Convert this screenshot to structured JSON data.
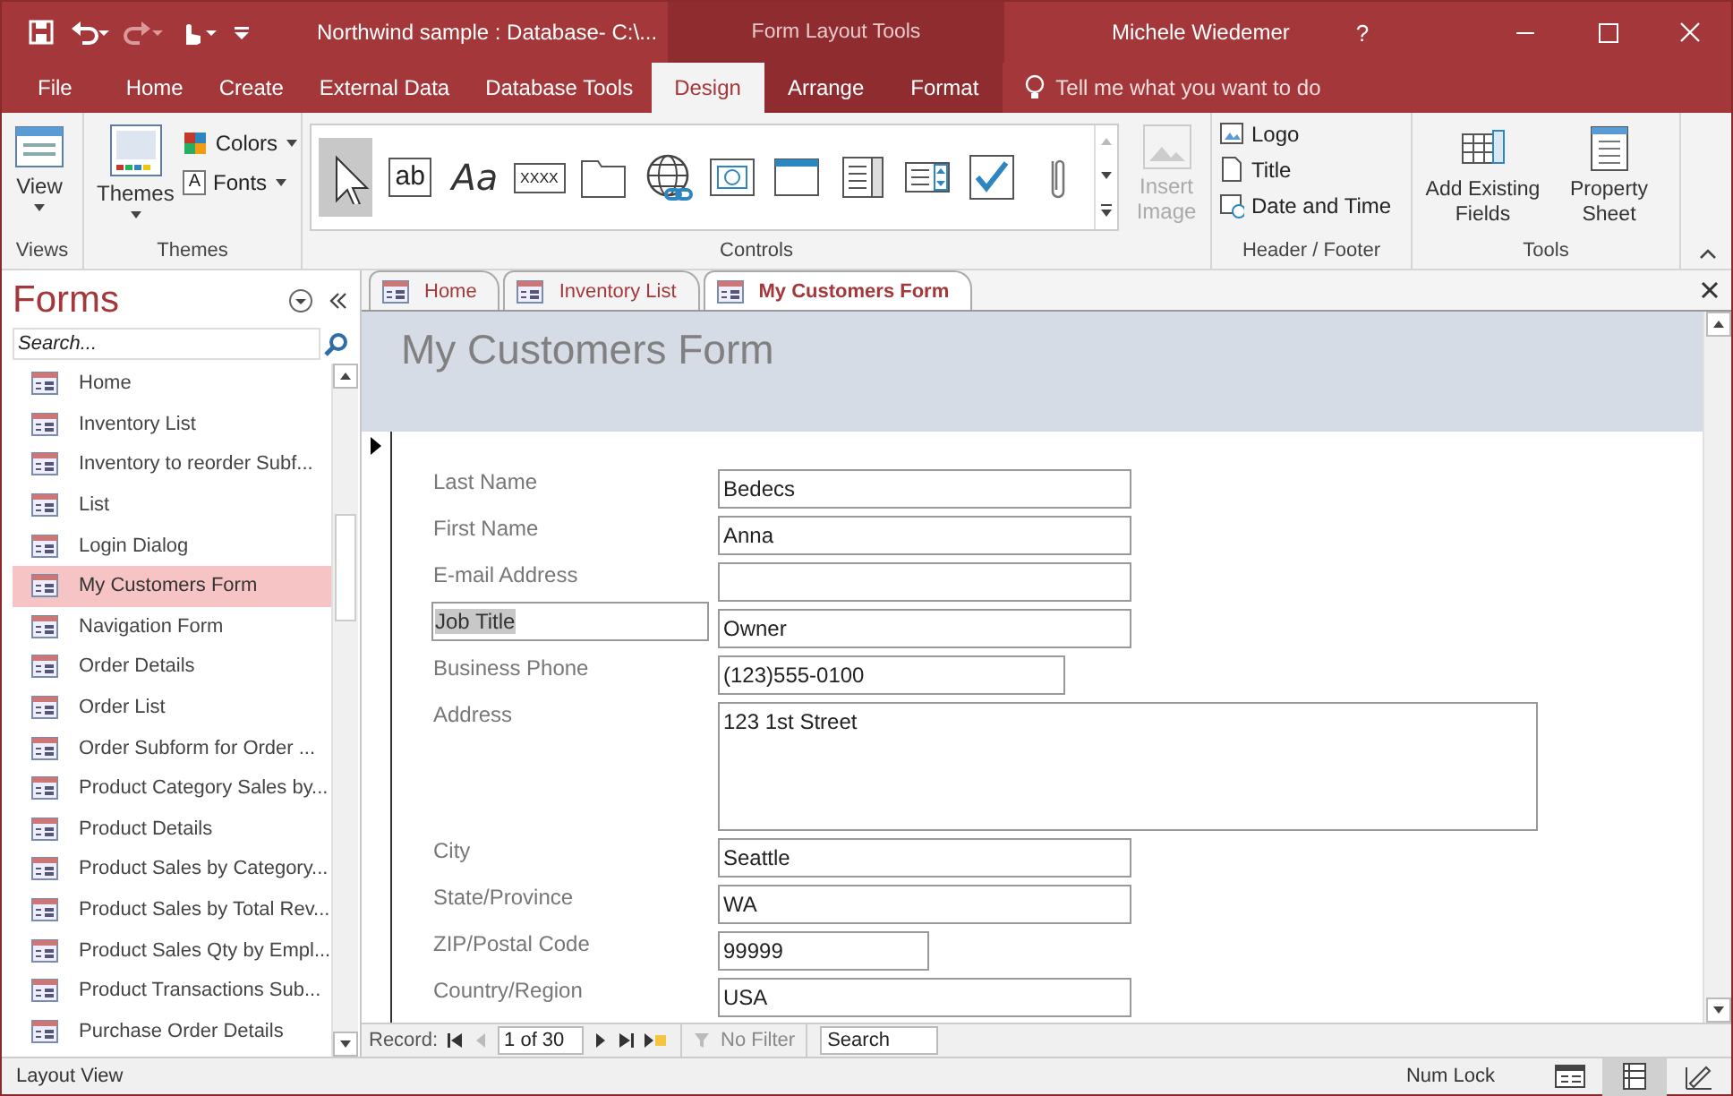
{
  "title_bar": {
    "title": "Northwind sample : Database- C:\\...",
    "context_label": "Form Layout Tools",
    "user": "Michele Wiedemer",
    "help": "?"
  },
  "ribbon_tabs": [
    {
      "label": "File",
      "selected": false,
      "contextual": false
    },
    {
      "label": "Home",
      "selected": false,
      "contextual": false
    },
    {
      "label": "Create",
      "selected": false,
      "contextual": false
    },
    {
      "label": "External Data",
      "selected": false,
      "contextual": false
    },
    {
      "label": "Database Tools",
      "selected": false,
      "contextual": false
    },
    {
      "label": "Design",
      "selected": true,
      "contextual": true
    },
    {
      "label": "Arrange",
      "selected": false,
      "contextual": true
    },
    {
      "label": "Format",
      "selected": false,
      "contextual": true
    }
  ],
  "tell_me": {
    "placeholder": "Tell me what you want to do"
  },
  "ribbon": {
    "views": {
      "label": "Views",
      "view": "View"
    },
    "themes": {
      "label": "Themes",
      "themes": "Themes",
      "colors": "Colors",
      "fonts": "Fonts",
      "fonts_glyph": "A"
    },
    "controls": {
      "label": "Controls",
      "items": [
        {
          "kind": "pointer",
          "selected": true
        },
        {
          "kind": "textbox",
          "text": "ab",
          "selected": false
        },
        {
          "kind": "label",
          "text": "Aa",
          "selected": false
        },
        {
          "kind": "button",
          "text": "XXXX",
          "selected": false
        },
        {
          "kind": "tab",
          "selected": false
        },
        {
          "kind": "hyperlink",
          "selected": false
        },
        {
          "kind": "browser",
          "selected": false
        },
        {
          "kind": "navigation",
          "selected": false
        },
        {
          "kind": "combo",
          "selected": false
        },
        {
          "kind": "list",
          "selected": false
        },
        {
          "kind": "checkbox",
          "selected": false
        },
        {
          "kind": "attachment",
          "selected": false
        }
      ],
      "insert_image": {
        "label": "Insert Image",
        "disabled": true
      }
    },
    "header_footer": {
      "label": "Header / Footer",
      "items": [
        {
          "kind": "logo",
          "label": "Logo"
        },
        {
          "kind": "title",
          "label": "Title"
        },
        {
          "kind": "date",
          "label": "Date and Time"
        }
      ]
    },
    "tools": {
      "label": "Tools",
      "items": [
        {
          "kind": "fields",
          "label": "Add Existing Fields"
        },
        {
          "kind": "sheet",
          "label": "Property Sheet"
        }
      ]
    }
  },
  "nav_pane": {
    "title": "Forms",
    "search": {
      "placeholder": "Search..."
    },
    "items": [
      {
        "label": "Home",
        "selected": false
      },
      {
        "label": "Inventory List",
        "selected": false
      },
      {
        "label": "Inventory to reorder Subf...",
        "selected": false
      },
      {
        "label": "List",
        "selected": false
      },
      {
        "label": "Login Dialog",
        "selected": false
      },
      {
        "label": "My Customers Form",
        "selected": true
      },
      {
        "label": "Navigation Form",
        "selected": false
      },
      {
        "label": "Order Details",
        "selected": false
      },
      {
        "label": "Order List",
        "selected": false
      },
      {
        "label": "Order Subform for Order ...",
        "selected": false
      },
      {
        "label": "Product Category Sales by...",
        "selected": false
      },
      {
        "label": "Product Details",
        "selected": false
      },
      {
        "label": "Product Sales by Category...",
        "selected": false
      },
      {
        "label": "Product Sales by Total Rev...",
        "selected": false
      },
      {
        "label": "Product Sales Qty by Empl...",
        "selected": false
      },
      {
        "label": "Product Transactions Sub...",
        "selected": false
      },
      {
        "label": "Purchase Order Details",
        "selected": false
      }
    ]
  },
  "doc_tabs": [
    {
      "label": "Home",
      "selected": false
    },
    {
      "label": "Inventory List",
      "selected": false
    },
    {
      "label": "My Customers Form",
      "selected": true
    }
  ],
  "form": {
    "title": "My Customers Form",
    "fields": [
      {
        "label": "Last Name",
        "value": "Bedecs",
        "kind": "text",
        "selected": false
      },
      {
        "label": "First Name",
        "value": "Anna",
        "kind": "text",
        "selected": false
      },
      {
        "label": "E-mail Address",
        "kind": "text",
        "selected": false
      },
      {
        "label": "Job Title",
        "value": "Owner",
        "kind": "text",
        "selected": true
      },
      {
        "label": "Business Phone",
        "value": "(123)555-0100",
        "kind": "phone",
        "selected": false
      },
      {
        "label": "Address",
        "value": "123 1st Street",
        "kind": "memo",
        "selected": false
      },
      {
        "label": "City",
        "value": "Seattle",
        "kind": "text",
        "selected": false
      },
      {
        "label": "State/Province",
        "value": "WA",
        "kind": "text",
        "selected": false
      },
      {
        "label": "ZIP/Postal Code",
        "value": "99999",
        "kind": "zip",
        "selected": false
      },
      {
        "label": "Country/Region",
        "value": "USA",
        "kind": "text",
        "selected": false
      }
    ]
  },
  "record_nav": {
    "label": "Record:",
    "position": "1 of 30",
    "filter": "No Filter",
    "search": "Search"
  },
  "status_bar": {
    "mode": "Layout View",
    "num_lock": "Num Lock",
    "views": [
      {
        "kind": "form",
        "selected": false
      },
      {
        "kind": "layout",
        "selected": true
      },
      {
        "kind": "design",
        "selected": false
      }
    ]
  }
}
